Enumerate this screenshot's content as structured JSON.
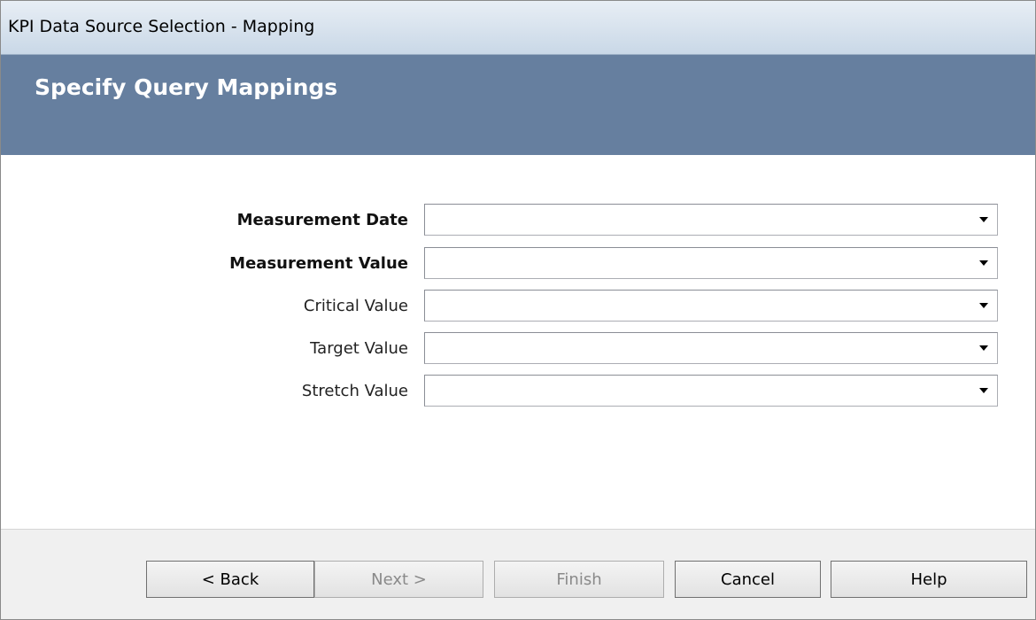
{
  "window": {
    "title": "KPI Data Source Selection - Mapping"
  },
  "header": {
    "heading": "Specify Query Mappings"
  },
  "fields": [
    {
      "label": "Measurement Date",
      "value": "",
      "required": true
    },
    {
      "label": "Measurement Value",
      "value": "",
      "required": true
    },
    {
      "label": "Critical Value",
      "value": "",
      "required": false
    },
    {
      "label": "Target Value",
      "value": "",
      "required": false
    },
    {
      "label": "Stretch Value",
      "value": "",
      "required": false
    }
  ],
  "buttons": {
    "back": "< Back",
    "next": "Next >",
    "finish": "Finish",
    "cancel": "Cancel",
    "help": "Help"
  },
  "icons": {
    "dropdown": "chevron-down-icon"
  }
}
